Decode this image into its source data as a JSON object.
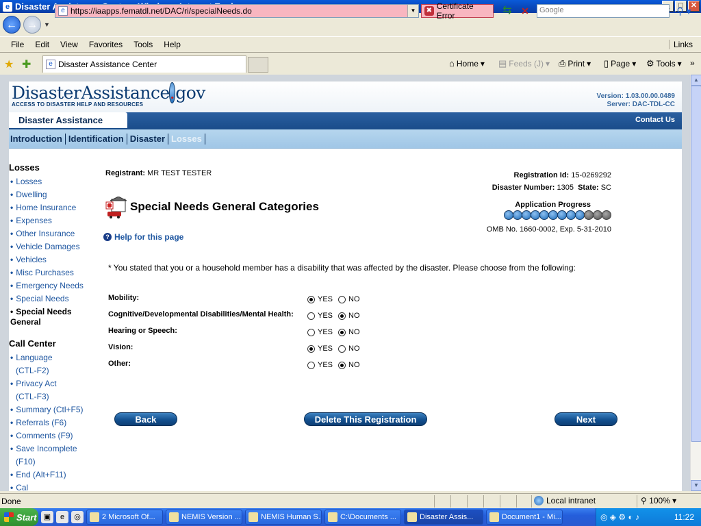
{
  "window": {
    "title": "Disaster Assistance Center - Windows Internet Explorer",
    "address": "https://iaapps.fematdl.net/DAC/ri/specialNeeds.do",
    "cert_error": "Certificate Error",
    "search_placeholder": "Google"
  },
  "menu": [
    "File",
    "Edit",
    "View",
    "Favorites",
    "Tools",
    "Help"
  ],
  "menu_links": "Links",
  "tab_title": "Disaster Assistance Center",
  "commands": {
    "home": "Home",
    "feeds": "Feeds (J)",
    "print": "Print",
    "page": "Page",
    "tools": "Tools"
  },
  "site": {
    "logo_main": "DisasterAssistance",
    "logo_dot": ".",
    "logo_gov": "gov",
    "logo_tagline": "ACCESS TO DISASTER HELP AND RESOURCES",
    "version": "Version: 1.03.00.00.0489",
    "server": "Server: DAC-TDL-CC",
    "header_tab": "Disaster Assistance",
    "contact": "Contact Us",
    "nav": [
      "Introduction",
      "Identification",
      "Disaster",
      "Losses"
    ]
  },
  "sidebar": {
    "losses_heading": "Losses",
    "losses": [
      "Losses",
      "Dwelling",
      "Home Insurance",
      "Expenses",
      "Other Insurance",
      "Vehicle Damages",
      "Vehicles",
      "Misc Purchases",
      "Emergency Needs",
      "Special Needs"
    ],
    "current": "Special Needs General",
    "call_heading": "Call Center",
    "call": [
      {
        "line1": "Language",
        "line2": "(CTL-F2)"
      },
      {
        "line1": "Privacy Act",
        "line2": "(CTL-F3)"
      },
      {
        "line1": "Summary (Ctl+F5)",
        "line2": ""
      },
      {
        "line1": "Referrals (F6)",
        "line2": ""
      },
      {
        "line1": "Comments (F9)",
        "line2": ""
      },
      {
        "line1": "Save Incomplete",
        "line2": "(F10)"
      },
      {
        "line1": "End (Alt+F11)",
        "line2": ""
      },
      {
        "line1": "Cal",
        "line2": ""
      }
    ]
  },
  "main": {
    "registrant_label": "Registrant:",
    "registrant": "MR TEST TESTER",
    "reg_id_label": "Registration Id:",
    "reg_id": "15-0269292",
    "disaster_label": "Disaster Number:",
    "disaster": "1305",
    "state_label": "State:",
    "state": "SC",
    "title": "Special Needs General Categories",
    "progress_label": "Application Progress",
    "progress_done": 9,
    "progress_total": 12,
    "omb": "OMB No. 1660-0002, Exp. 5-31-2010",
    "help": "Help for this page",
    "intro": "* You stated that you or a household member has a disability that was affected by the disaster. Please choose from the following:",
    "yes": "YES",
    "no": "NO",
    "questions": [
      {
        "label": "Mobility:",
        "answer": "yes"
      },
      {
        "label": "Cognitive/Developmental Disabilities/Mental Health:",
        "answer": "no"
      },
      {
        "label": "Hearing or Speech:",
        "answer": "no"
      },
      {
        "label": "Vision:",
        "answer": "yes"
      },
      {
        "label": "Other:",
        "answer": "no"
      }
    ],
    "back": "Back",
    "delete": "Delete This Registration",
    "next": "Next"
  },
  "status": {
    "text": "Done",
    "zone": "Local intranet",
    "zoom": "100%"
  },
  "taskbar": {
    "start": "Start",
    "items": [
      "2 Microsoft Of...",
      "NEMIS Version ...",
      "NEMIS Human S...",
      "C:\\Documents ...",
      "Disaster Assis...",
      "Document1 - Mi..."
    ],
    "clock": "11:22"
  }
}
